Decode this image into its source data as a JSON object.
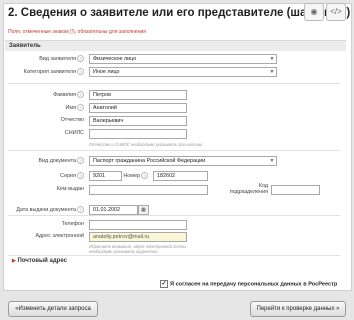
{
  "header": {
    "title": "2. Сведения о заявителе или его представителе (шаг 2 из 3)",
    "icons": [
      "eye-icon",
      "code-icon"
    ]
  },
  "required_note": "Поля, отмеченные знаком (!), обязательны для заполнения",
  "section_title": "Заявитель",
  "applicant": {
    "type_label": "Вид заявителя",
    "type_value": "Физическое лицо",
    "category_label": "Категория заявителя",
    "category_value": "Иное лицо"
  },
  "person": {
    "last_name_label": "Фамилия",
    "last_name_value": "Петров",
    "first_name_label": "Имя",
    "first_name_value": "Анатолий",
    "middle_name_label": "Отчество",
    "middle_name_value": "Валерьевич",
    "snils_label": "СНИЛС",
    "snils_value": "",
    "snils_hint": "Отчество и СНИЛС необходимо указывать при наличии"
  },
  "document": {
    "type_label": "Вид документа",
    "type_value": "Паспорт гражданина Российской Федерации",
    "series_label": "Серия",
    "series_value": "9201",
    "number_label": "Номер",
    "number_value": "182602",
    "issued_by_label": "Кем выдан",
    "issued_by_value": "",
    "code_label_1": "Код",
    "code_label_2": "подразделения",
    "code_value": "",
    "date_label": "Дата выдачи документа",
    "date_value": "01.01.2002",
    "calendar_icon": "calendar-icon"
  },
  "contacts": {
    "phone_label": "Телефон",
    "phone_value": "",
    "email_label_1": "Адрес",
    "email_label_2": "электронной",
    "email_value": "anatoliy.petrov@mail.ru",
    "email_hint": "Обратите внимание, адрес электронной почты необходимо указывать корректно"
  },
  "postal_label": "Почтовый адрес",
  "consent_label": "Я согласен на передачу персональных данных в РосРеестр",
  "buttons": {
    "back": "«Изменить детали запроса",
    "next": "Перейти к проверке данных »"
  }
}
